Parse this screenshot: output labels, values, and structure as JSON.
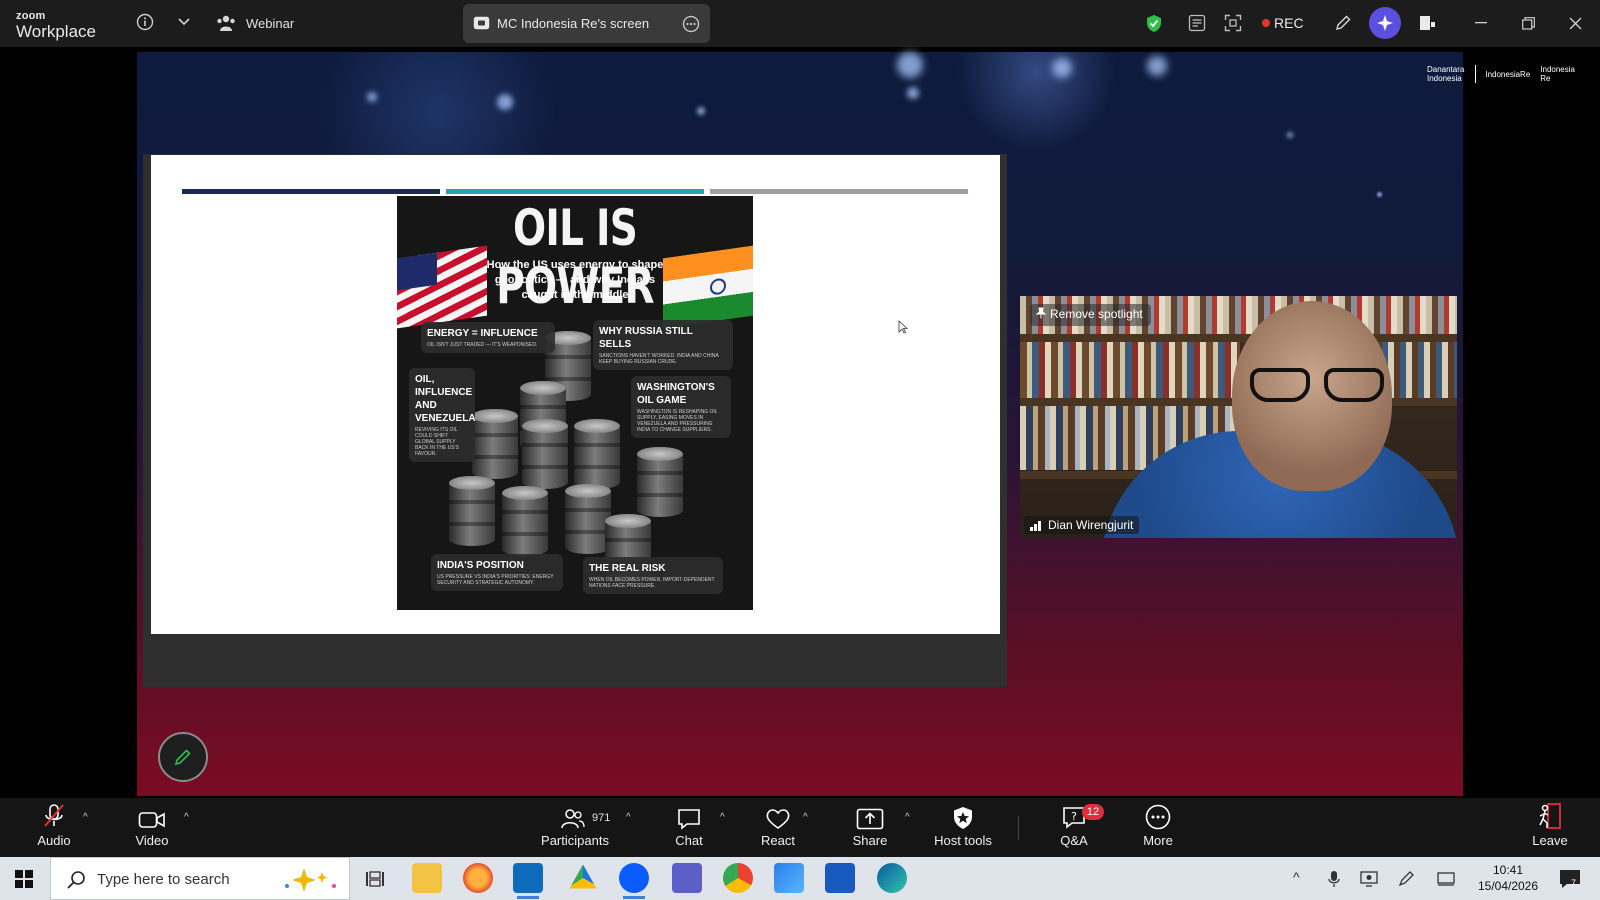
{
  "titlebar": {
    "brand_top": "zoom",
    "brand_bottom": "Workplace",
    "webinar_label": "Webinar",
    "screen_share_label": "MC Indonesia Re's screen",
    "rec_label": "REC",
    "colors": {
      "rec_dot": "#e5322e",
      "shield": "#2fbf4a",
      "ai_button": "#5b4fe0"
    }
  },
  "stage": {
    "partner_logos": [
      "Danantara Indonesia",
      "IndonesiaRe",
      "Indonesia Re"
    ],
    "slide": {
      "bar_colors": [
        "#1a2b50",
        "#2aa1b3",
        "#9aa0a6"
      ],
      "poster": {
        "title": "OIL IS POWER",
        "subtitle": "How the US uses energy to shape geopolitics — and why India is caught in the middle",
        "cards": [
          {
            "heading": "ENERGY = INFLUENCE",
            "body": "OIL ISN'T JUST TRADED — IT'S WEAPONISED."
          },
          {
            "heading": "WHY RUSSIA STILL SELLS",
            "body": "SANCTIONS HAVEN'T WORKED. INDIA AND CHINA KEEP BUYING RUSSIAN CRUDE."
          },
          {
            "heading": "OIL, INFLUENCE AND VENEZUELA",
            "body": "REVIVING ITS OIL COULD SHIFT GLOBAL SUPPLY BACK IN THE US'S FAVOUR."
          },
          {
            "heading": "WASHINGTON'S OIL GAME",
            "body": "WASHINGTON IS RESHAPING OIL SUPPLY, EASING MOVES IN VENEZUELA AND PRESSURING INDIA TO CHANGE SUPPLIERS."
          },
          {
            "heading": "INDIA'S POSITION",
            "body": "US PRESSURE VS INDIA'S PRIORITIES: ENERGY SECURITY AND STRATEGIC AUTONOMY."
          },
          {
            "heading": "THE REAL RISK",
            "body": "WHEN OIL BECOMES POWER, IMPORT-DEPENDENT NATIONS FACE PRESSURE."
          }
        ]
      }
    },
    "spotlight": {
      "remove_label": "Remove spotlight",
      "participant_name": "Dian Wirengjurit"
    }
  },
  "controls": {
    "audio_label": "Audio",
    "video_label": "Video",
    "participants_label": "Participants",
    "participants_count": "971",
    "chat_label": "Chat",
    "react_label": "React",
    "share_label": "Share",
    "host_tools_label": "Host tools",
    "qa_label": "Q&A",
    "qa_badge": "12",
    "more_label": "More",
    "leave_label": "Leave",
    "colors": {
      "leave": "#e02e3f",
      "badge": "#e02e3f"
    }
  },
  "taskbar": {
    "search_placeholder": "Type here to search",
    "time": "10:41",
    "date": "15/04/2026",
    "notification_count": "7"
  }
}
